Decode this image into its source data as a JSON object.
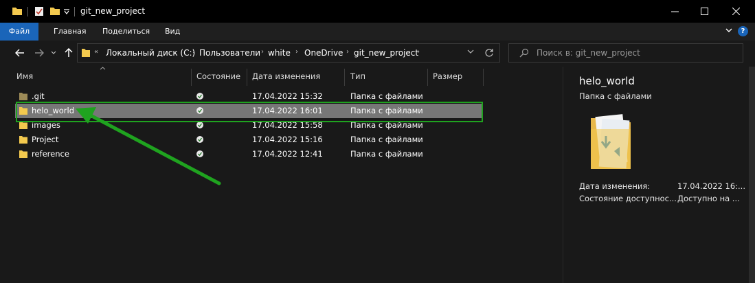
{
  "window": {
    "title": "git_new_project",
    "controls": {
      "minimize": "minimize-icon",
      "maximize": "maximize-icon",
      "close": "close-icon"
    }
  },
  "ribbon": {
    "tabs": [
      "Файл",
      "Главная",
      "Поделиться",
      "Вид"
    ],
    "accent": "#1a65b9"
  },
  "navigation": {
    "overflow": "«",
    "breadcrumb": [
      "Локальный диск (C:)",
      "Пользователи",
      "white",
      "OneDrive",
      "git_new_project"
    ],
    "search_placeholder": "Поиск в: git_new_project"
  },
  "columns": [
    "Имя",
    "Состояние",
    "Дата изменения",
    "Тип",
    "Размер"
  ],
  "files": [
    {
      "name": ".git",
      "date": "17.04.2022 15:32",
      "type": "Папка с файлами",
      "selected": false
    },
    {
      "name": "helo_world",
      "date": "17.04.2022 16:01",
      "type": "Папка с файлами",
      "selected": true
    },
    {
      "name": "images",
      "date": "17.04.2022 15:58",
      "type": "Папка с файлами",
      "selected": false
    },
    {
      "name": "Project",
      "date": "17.04.2022 15:16",
      "type": "Папка с файлами",
      "selected": false
    },
    {
      "name": "reference",
      "date": "17.04.2022 12:41",
      "type": "Папка с файлами",
      "selected": false
    }
  ],
  "details": {
    "title": "helo_world",
    "subtitle": "Папка с файлами",
    "rows": [
      {
        "label": "Дата изменения:",
        "value": "17.04.2022 16:..."
      },
      {
        "label": "Состояние доступнос...",
        "value": "Доступно на ..."
      }
    ]
  },
  "annotation": {
    "highlight_color": "#1fa31f"
  }
}
